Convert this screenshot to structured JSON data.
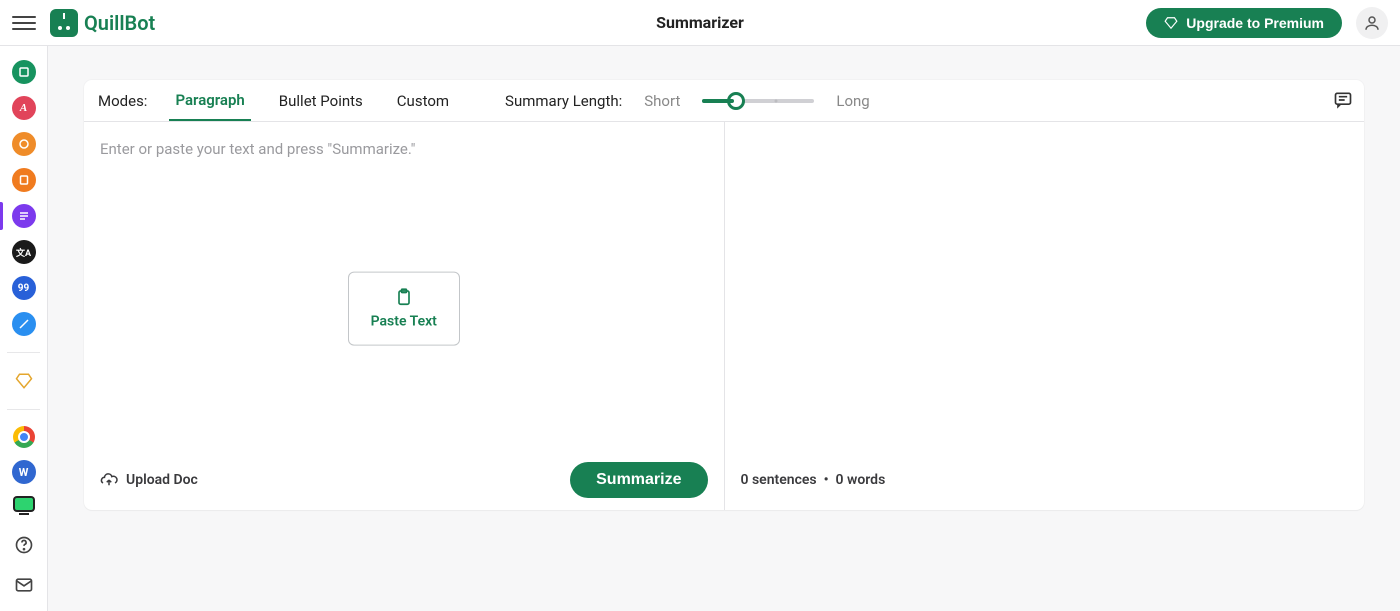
{
  "brand": {
    "name": "QuillBot"
  },
  "header": {
    "title": "Summarizer",
    "upgrade_label": "Upgrade to Premium"
  },
  "sidebar": {
    "tools": [
      {
        "id": "paraphraser",
        "color": "chip-green"
      },
      {
        "id": "grammar-checker",
        "color": "chip-red"
      },
      {
        "id": "plagiarism-checker",
        "color": "chip-orange"
      },
      {
        "id": "co-writer",
        "color": "chip-orange2"
      },
      {
        "id": "summarizer",
        "color": "chip-purple",
        "active": true
      },
      {
        "id": "translator",
        "color": "chip-black"
      },
      {
        "id": "citation-generator",
        "color": "chip-blue"
      },
      {
        "id": "extensions",
        "color": "chip-lblue"
      }
    ],
    "premium_icon": "premium"
  },
  "modes": {
    "label": "Modes:",
    "tabs": [
      "Paragraph",
      "Bullet Points",
      "Custom"
    ],
    "active_index": 0
  },
  "length": {
    "label": "Summary Length:",
    "min_label": "Short",
    "max_label": "Long"
  },
  "editor": {
    "placeholder": "Enter or paste your text and press \"Summarize.\"",
    "paste_label": "Paste Text",
    "upload_label": "Upload Doc",
    "summarize_label": "Summarize"
  },
  "output": {
    "sentences_count": 0,
    "sentences_word": "sentences",
    "separator": "•",
    "words_count": 0,
    "words_word": "words"
  }
}
